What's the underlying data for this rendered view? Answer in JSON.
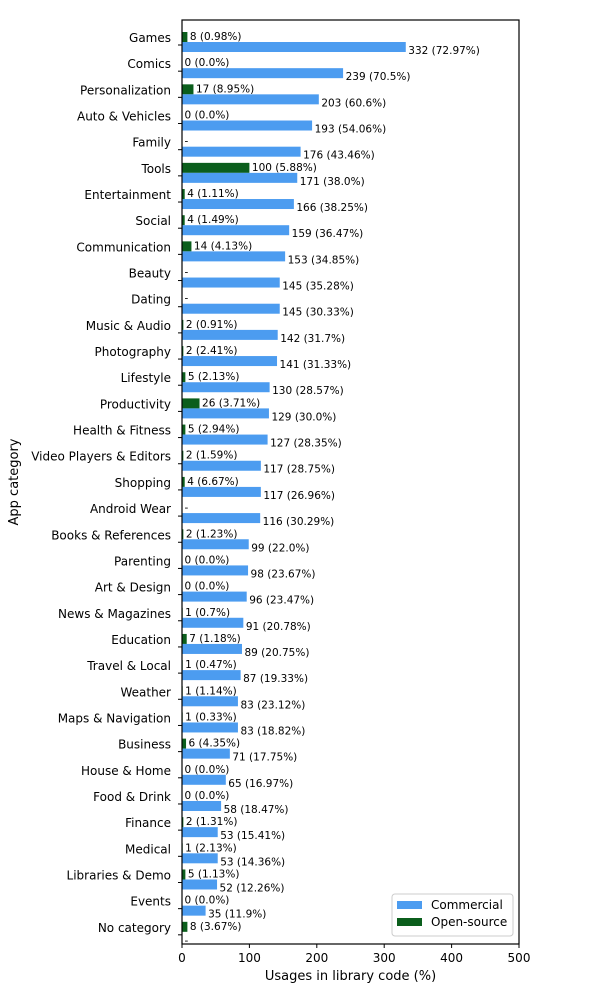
{
  "chart_data": {
    "type": "bar",
    "orientation": "horizontal",
    "title": "",
    "xlabel": "Usages in library code (%)",
    "ylabel": "App category",
    "xlim": [
      0,
      500
    ],
    "xticks": [
      0,
      100,
      200,
      300,
      400,
      500
    ],
    "grid": false,
    "legend_position": "bottom-right",
    "categories": [
      "Games",
      "Comics",
      "Personalization",
      "Auto & Vehicles",
      "Family",
      "Tools",
      "Entertainment",
      "Social",
      "Communication",
      "Beauty",
      "Dating",
      "Music & Audio",
      "Photography",
      "Lifestyle",
      "Productivity",
      "Health & Fitness",
      "Video Players & Editors",
      "Shopping",
      "Android Wear",
      "Books & References",
      "Parenting",
      "Art & Design",
      "News & Magazines",
      "Education",
      "Travel & Local",
      "Weather",
      "Maps & Navigation",
      "Business",
      "House & Home",
      "Food & Drink",
      "Finance",
      "Medical",
      "Libraries & Demo",
      "Events",
      "No category"
    ],
    "series": [
      {
        "name": "Commercial",
        "color": "#4c9cf0",
        "values": [
          332,
          239,
          203,
          193,
          176,
          171,
          166,
          159,
          153,
          145,
          145,
          142,
          141,
          130,
          129,
          127,
          117,
          117,
          116,
          99,
          98,
          96,
          91,
          89,
          87,
          83,
          83,
          71,
          65,
          58,
          53,
          53,
          52,
          35,
          null
        ],
        "labels": [
          "332 (72.97%)",
          "239 (70.5%)",
          "203 (60.6%)",
          "193 (54.06%)",
          "176 (43.46%)",
          "171 (38.0%)",
          "166 (38.25%)",
          "159 (36.47%)",
          "153 (34.85%)",
          "145 (35.28%)",
          "145 (30.33%)",
          "142 (31.7%)",
          "141 (31.33%)",
          "130 (28.57%)",
          "129 (30.0%)",
          "127 (28.35%)",
          "117 (28.75%)",
          "117 (26.96%)",
          "116 (30.29%)",
          "99 (22.0%)",
          "98 (23.67%)",
          "96 (23.47%)",
          "91 (20.78%)",
          "89 (20.75%)",
          "87 (19.33%)",
          "83 (23.12%)",
          "83 (18.82%)",
          "71 (17.75%)",
          "65 (16.97%)",
          "58 (18.47%)",
          "53 (15.41%)",
          "53 (14.36%)",
          "52 (12.26%)",
          "35 (11.9%)",
          "-"
        ]
      },
      {
        "name": "Open-source",
        "color": "#0b5e1c",
        "values": [
          8,
          0,
          17,
          0,
          null,
          100,
          4,
          4,
          14,
          null,
          null,
          2,
          2,
          5,
          26,
          5,
          2,
          4,
          null,
          2,
          0,
          0,
          1,
          7,
          1,
          1,
          1,
          6,
          0,
          0,
          2,
          1,
          5,
          0,
          8
        ],
        "labels": [
          "8 (0.98%)",
          "0 (0.0%)",
          "17 (8.95%)",
          "0 (0.0%)",
          "-",
          "100 (5.88%)",
          "4 (1.11%)",
          "4 (1.49%)",
          "14 (4.13%)",
          "-",
          "-",
          "2 (0.91%)",
          "2 (2.41%)",
          "5 (2.13%)",
          "26 (3.71%)",
          "5 (2.94%)",
          "2 (1.59%)",
          "4 (6.67%)",
          "-",
          "2 (1.23%)",
          "0 (0.0%)",
          "0 (0.0%)",
          "1 (0.7%)",
          "7 (1.18%)",
          "1 (0.47%)",
          "1 (1.14%)",
          "1 (0.33%)",
          "6 (4.35%)",
          "0 (0.0%)",
          "0 (0.0%)",
          "2 (1.31%)",
          "1 (2.13%)",
          "5 (1.13%)",
          "0 (0.0%)",
          "8 (3.67%)"
        ]
      }
    ]
  }
}
